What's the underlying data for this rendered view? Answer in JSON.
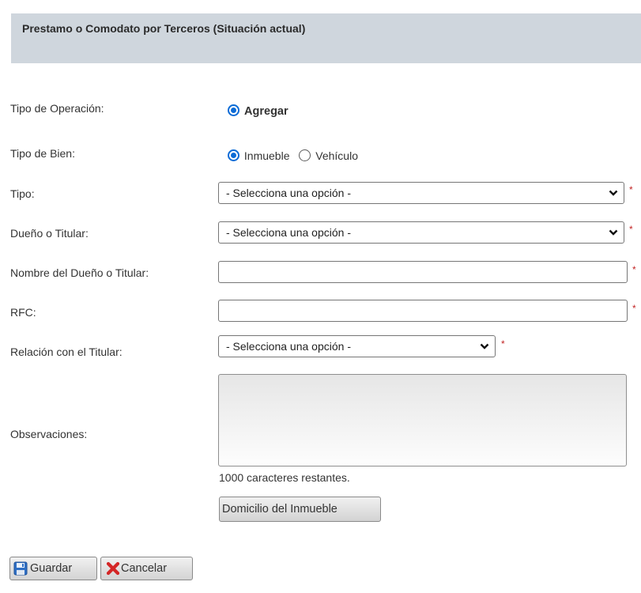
{
  "header": {
    "title": "Prestamo o Comodato por Terceros (Situación actual)"
  },
  "form": {
    "tipo_operacion": {
      "label": "Tipo de Operación:",
      "option": "Agregar"
    },
    "tipo_bien": {
      "label": "Tipo de Bien:",
      "option_1": "Inmueble",
      "option_2": "Vehículo",
      "selected": "Inmueble"
    },
    "tipo": {
      "label": "Tipo:",
      "value": "- Selecciona una opción -"
    },
    "dueno": {
      "label": "Dueño o Titular:",
      "value": "- Selecciona una opción -"
    },
    "nombre_dueno": {
      "label": "Nombre del Dueño o Titular:",
      "value": ""
    },
    "rfc": {
      "label": "RFC:",
      "value": ""
    },
    "relacion": {
      "label": "Relación con el Titular:",
      "value": "- Selecciona una opción -"
    },
    "observaciones": {
      "label": "Observaciones:",
      "value": "",
      "counter": "1000 caracteres restantes."
    },
    "required_mark": "*"
  },
  "buttons": {
    "domicilio": "Domicilio del Inmueble",
    "guardar": "Guardar",
    "cancelar": "Cancelar"
  },
  "colors": {
    "header_bg": "#cfd6dd",
    "radio_accent": "#0b6bd6",
    "required": "#c22424"
  },
  "icons": {
    "guardar": "floppy-disk-icon",
    "cancelar": "red-x-icon",
    "select": "chevron-down-icon"
  }
}
